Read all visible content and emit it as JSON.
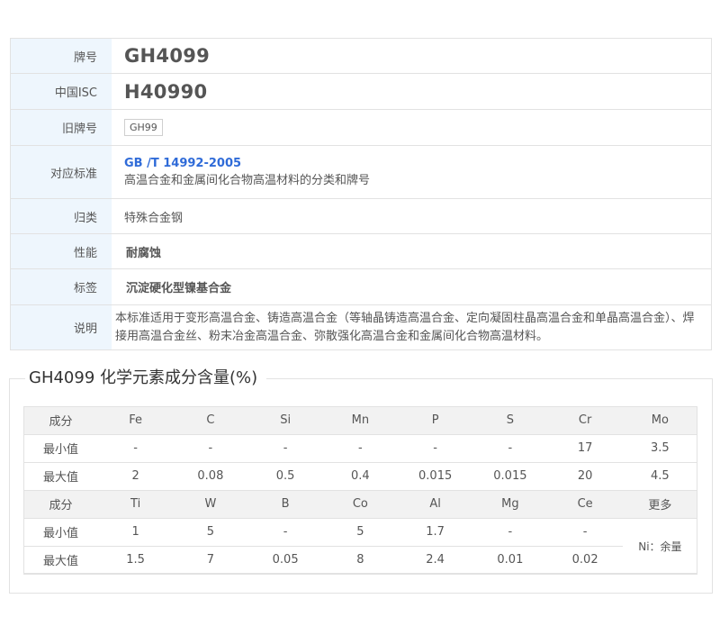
{
  "info": {
    "brand_label": "牌号",
    "brand_value": "GH4099",
    "isc_label": "中国ISC",
    "isc_value": "H40990",
    "old_label": "旧牌号",
    "old_value": "GH99",
    "standard_label": "对应标准",
    "standard_code": "GB /T 14992-2005",
    "standard_name": "高温合金和金属间化合物高温材料的分类和牌号",
    "category_label": "归类",
    "category_value": "特殊合金钢",
    "property_label": "性能",
    "property_value": "耐腐蚀",
    "tag_label": "标签",
    "tag_value": "沉淀硬化型镍基合金",
    "desc_label": "说明",
    "desc_value": "本标准适用于变形高温合金、铸造高温合金（等轴晶铸造高温合金、定向凝固柱晶高温合金和单晶高温合金）、焊接用高温合金丝、粉末冶金高温合金、弥散强化高温合金和金属间化合物高温材料。"
  },
  "chem": {
    "title": "GH4099 化学元素成分含量(%)",
    "header_label": "成分",
    "min_label": "最小值",
    "max_label": "最大值",
    "group1": {
      "elements": [
        "Fe",
        "C",
        "Si",
        "Mn",
        "P",
        "S",
        "Cr",
        "Mo"
      ],
      "min": [
        "-",
        "-",
        "-",
        "-",
        "-",
        "-",
        "17",
        "3.5"
      ],
      "max": [
        "2",
        "0.08",
        "0.5",
        "0.4",
        "0.015",
        "0.015",
        "20",
        "4.5"
      ]
    },
    "group2": {
      "elements": [
        "Ti",
        "W",
        "B",
        "Co",
        "Al",
        "Mg",
        "Ce"
      ],
      "min": [
        "1",
        "5",
        "-",
        "5",
        "1.7",
        "-",
        "-"
      ],
      "max": [
        "1.5",
        "7",
        "0.05",
        "8",
        "2.4",
        "0.01",
        "0.02"
      ]
    },
    "more_label": "更多",
    "remainder": "Ni：余量"
  }
}
